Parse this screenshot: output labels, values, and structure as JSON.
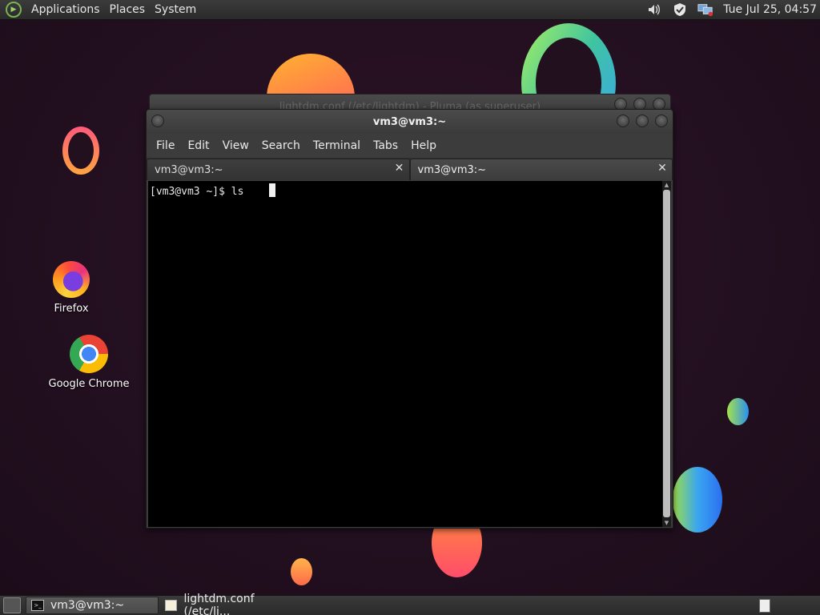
{
  "top_panel": {
    "menus": [
      "Applications",
      "Places",
      "System"
    ],
    "clock": "Tue Jul 25, 04:57",
    "tray_icons": [
      "volume-icon",
      "shield-icon",
      "network-icon"
    ]
  },
  "desktop_icons": [
    {
      "label": "Firefox",
      "icon": "firefox-icon"
    },
    {
      "label": "Google Chrome",
      "icon": "chrome-icon"
    }
  ],
  "background_window": {
    "title": "lightdm.conf (/etc/lightdm) - Pluma (as superuser)"
  },
  "terminal": {
    "title": "vm3@vm3:~",
    "menu": [
      "File",
      "Edit",
      "View",
      "Search",
      "Terminal",
      "Tabs",
      "Help"
    ],
    "tabs": [
      {
        "label": "vm3@vm3:~",
        "active": false
      },
      {
        "label": "vm3@vm3:~",
        "active": true
      }
    ],
    "prompt_line": "[vm3@vm3 ~]$ ls"
  },
  "taskbar": {
    "tasks": [
      {
        "label": "vm3@vm3:~",
        "active": true,
        "icon": "terminal-icon"
      },
      {
        "label": "lightdm.conf (/etc/li...",
        "active": false,
        "icon": "pluma-icon"
      }
    ]
  }
}
